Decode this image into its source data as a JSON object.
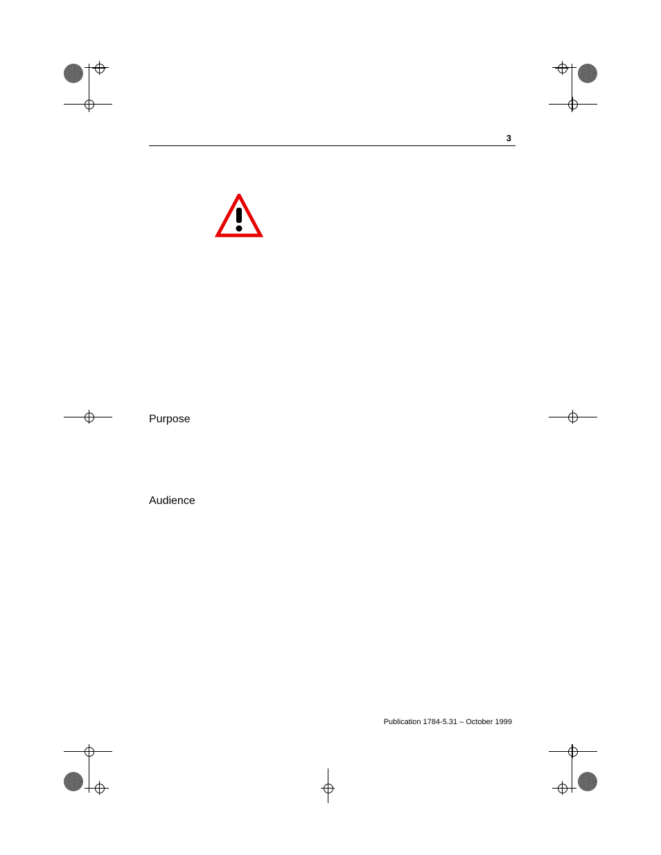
{
  "page_number": "3",
  "headings": {
    "purpose": "Purpose",
    "audience": "Audience"
  },
  "footer": "Publication 1784-5.31 – October 1999"
}
